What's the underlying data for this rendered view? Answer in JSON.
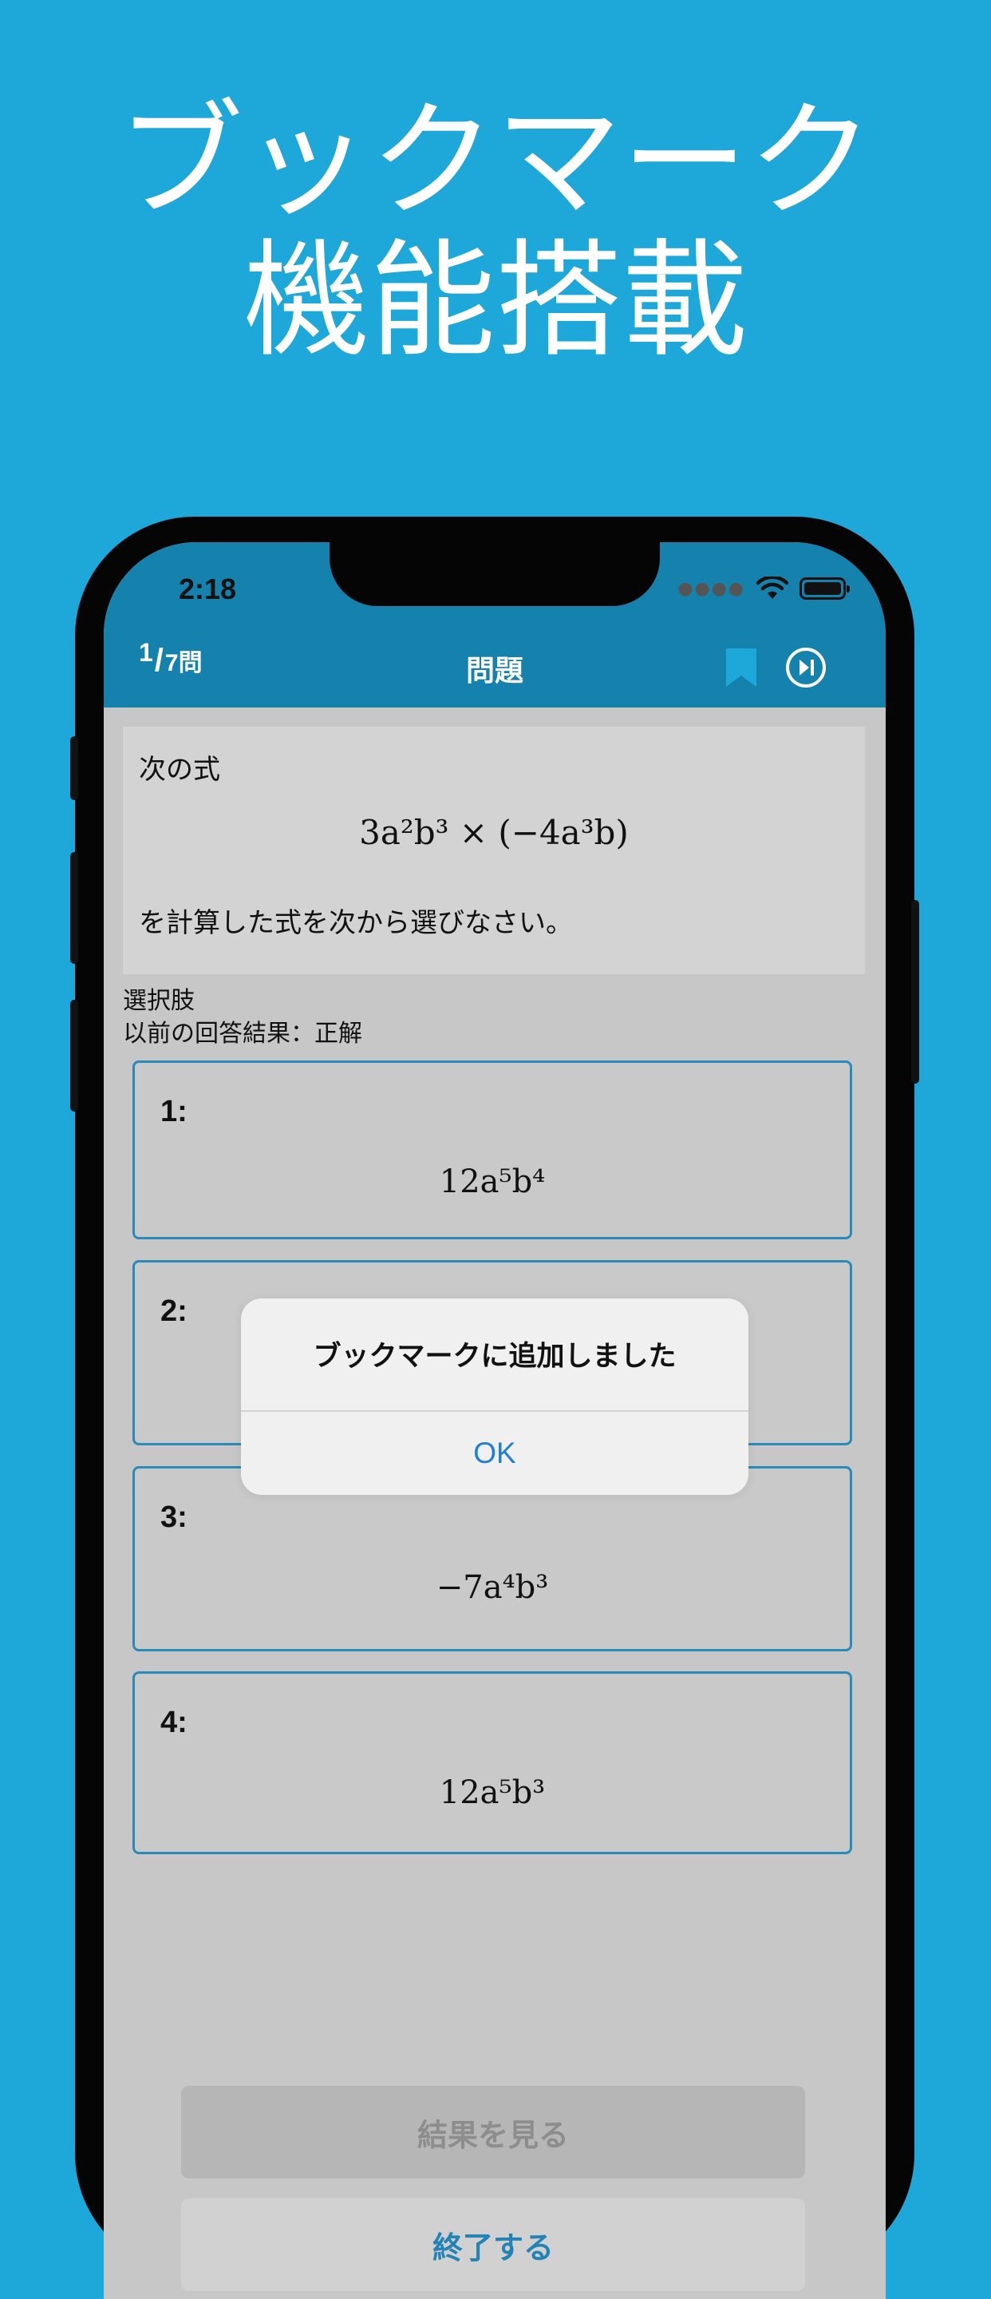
{
  "headline": {
    "line1": "ブックマーク",
    "line2": "機能搭載"
  },
  "status_bar": {
    "time": "2:18"
  },
  "navbar": {
    "counter_current": "1",
    "counter_slash": "/",
    "counter_total": "7問",
    "title": "問題",
    "bookmark_icon": "bookmark-icon",
    "skip_icon": "skip-forward-icon",
    "bookmark_color": "#1ea7d9"
  },
  "question": {
    "line1": "次の式",
    "formula": "3a²b³ × (−4a³b)",
    "line3": "を計算した式を次から選びなさい。"
  },
  "choices_label": "選択肢",
  "previous_result": "以前の回答結果：正解",
  "choices": [
    {
      "number": "1:",
      "formula": "12a⁵b⁴"
    },
    {
      "number": "2:",
      "formula": ""
    },
    {
      "number": "3:",
      "formula": "−7a⁴b³"
    },
    {
      "number": "4:",
      "formula": "12a⁵b³"
    }
  ],
  "buttons": {
    "results": "結果を見る",
    "finish": "終了する"
  },
  "alert": {
    "message": "ブックマークに追加しました",
    "ok": "OK"
  },
  "colors": {
    "background": "#1ea7d9",
    "navbar": "#1582ae",
    "accent": "#1f7fd6"
  }
}
